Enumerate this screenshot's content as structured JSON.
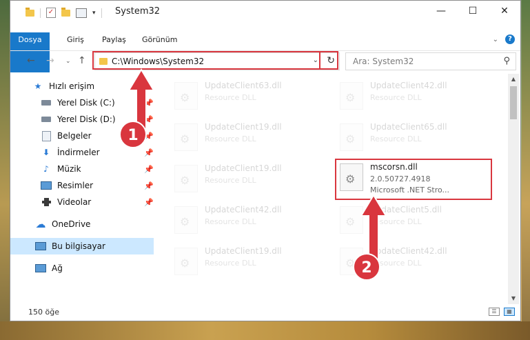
{
  "window": {
    "title": "System32"
  },
  "ribbon": {
    "tabs": [
      "Dosya",
      "Giriş",
      "Paylaş",
      "Görünüm"
    ]
  },
  "address": {
    "path": "C:\\Windows\\System32"
  },
  "search": {
    "placeholder": "Ara: System32"
  },
  "sidebar": {
    "items": [
      {
        "label": "Hızlı erişim",
        "icon": "star-icon"
      },
      {
        "label": "Yerel Disk (C:)",
        "icon": "drive-icon",
        "pinned": true
      },
      {
        "label": "Yerel Disk (D:)",
        "icon": "drive-icon",
        "pinned": true
      },
      {
        "label": "Belgeler",
        "icon": "documents-icon",
        "pinned": true
      },
      {
        "label": "İndirmeler",
        "icon": "download-icon",
        "pinned": true
      },
      {
        "label": "Müzik",
        "icon": "music-icon",
        "pinned": true
      },
      {
        "label": "Resimler",
        "icon": "pictures-icon",
        "pinned": true
      },
      {
        "label": "Videolar",
        "icon": "videos-icon",
        "pinned": true
      },
      {
        "label": "OneDrive",
        "icon": "cloud-icon"
      },
      {
        "label": "Bu bilgisayar",
        "icon": "computer-icon",
        "selected": true
      },
      {
        "label": "Ağ",
        "icon": "network-icon"
      }
    ]
  },
  "files": [
    {
      "name": "UpdateClient63.dll",
      "sub1": "Resource DLL"
    },
    {
      "name": "UpdateClient42.dll",
      "sub1": "Resource DLL"
    },
    {
      "name": "UpdateClient19.dll",
      "sub1": "Resource DLL"
    },
    {
      "name": "UpdateClient65.dll",
      "sub1": "Resource DLL"
    },
    {
      "name": "UpdateClient19.dll",
      "sub1": "Resource DLL"
    },
    {
      "name": "mscorsn.dll",
      "sub1": "2.0.50727.4918",
      "sub2": "Microsoft .NET Stro..."
    },
    {
      "name": "UpdateClient42.dll",
      "sub1": "Resource DLL"
    },
    {
      "name": "UpdateClient5.dll",
      "sub1": "Resource DLL"
    },
    {
      "name": "UpdateClient19.dll",
      "sub1": "Resource DLL"
    },
    {
      "name": "UpdateClient42.dll",
      "sub1": "Resource DLL"
    }
  ],
  "status": {
    "count": "150 öğe"
  },
  "annotations": {
    "badge1": "1",
    "badge2": "2"
  },
  "colors": {
    "accent": "#1979ca",
    "highlight": "#d9363e"
  }
}
